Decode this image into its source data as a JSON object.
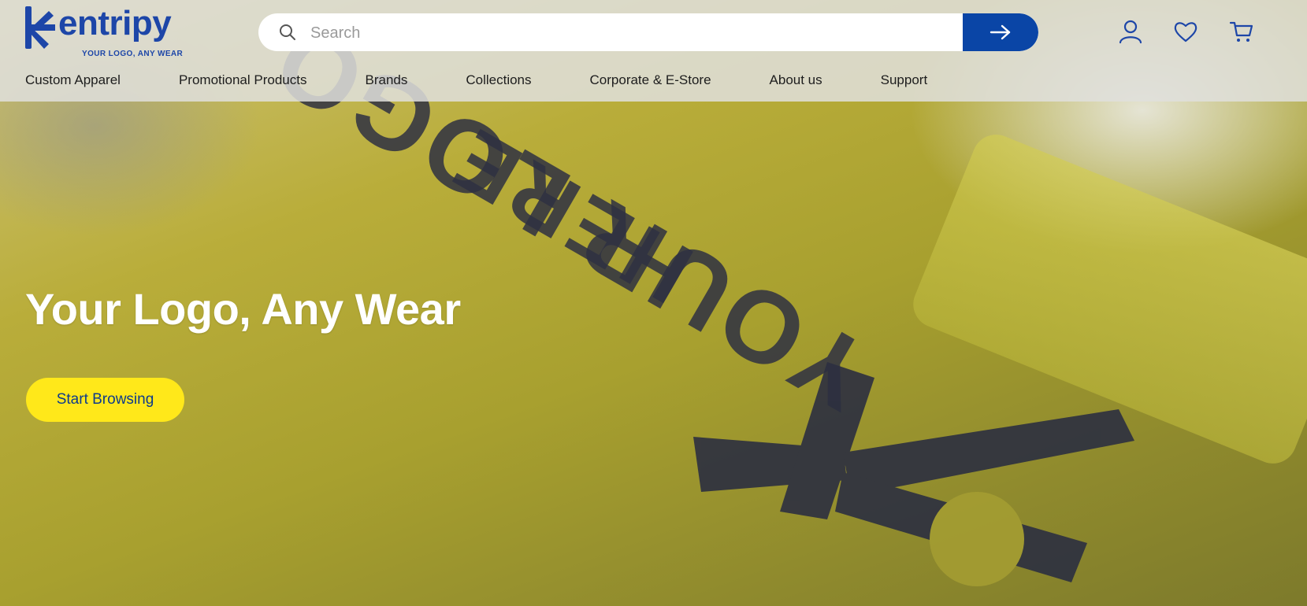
{
  "brand": {
    "name": "entripy",
    "tagline": "YOUR LOGO, ANY WEAR",
    "color": "#1d46a8"
  },
  "search": {
    "placeholder": "Search",
    "value": "",
    "submit_icon": "arrow-right-icon",
    "button_color": "#0a45a6"
  },
  "header_icons": [
    "user-icon",
    "heart-icon",
    "cart-icon"
  ],
  "nav": {
    "items": [
      {
        "label": "Custom Apparel"
      },
      {
        "label": "Promotional Products"
      },
      {
        "label": "Brands"
      },
      {
        "label": "Collections"
      },
      {
        "label": "Corporate & E-Store"
      },
      {
        "label": "About us"
      },
      {
        "label": "Support"
      }
    ]
  },
  "hero": {
    "title": "Your Logo, Any Wear",
    "cta_label": "Start Browsing",
    "cta_color": "#ffe81a",
    "image_print_text": [
      "YOUR LOGO",
      "HERE"
    ]
  }
}
